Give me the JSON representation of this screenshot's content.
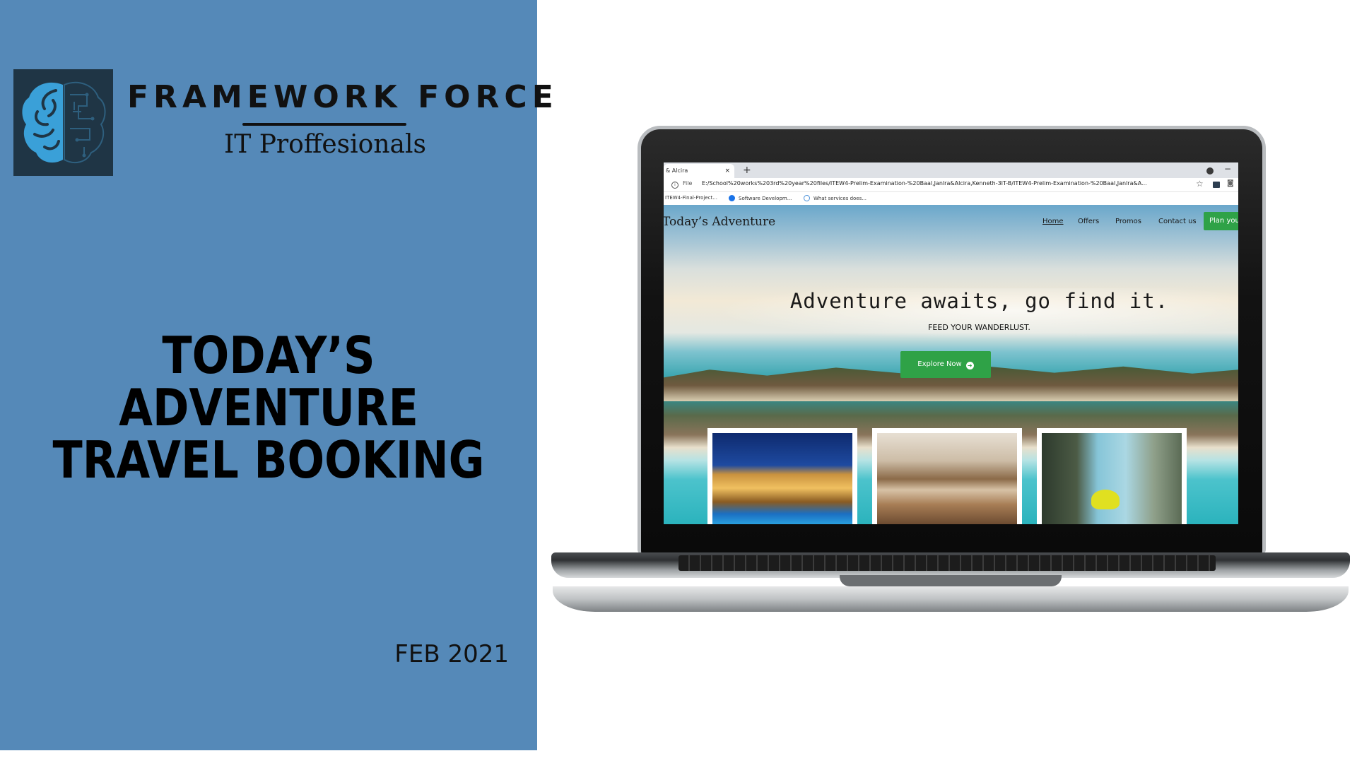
{
  "brand": {
    "name": "FRAMEWORK FORCE",
    "subtitle": "IT Proffesionals",
    "logo_icon": "brain-circuit-icon"
  },
  "headline": {
    "line1": "TODAY’S ADVENTURE",
    "line2": "TRAVEL BOOKING"
  },
  "date": "FEB 2021",
  "browser": {
    "tab_title": "& Alcira",
    "tab_close": "×",
    "new_tab": "+",
    "minimize": "−",
    "file_label": "File",
    "url": "E:/School%20works%203rd%20year%20files/ITEW4-Prelim-Examination-%20Baal,Janlra&Alcira,Kenneth-3IT-B/ITEW4-Prelim-Examination-%20Baal,Janlra&A...",
    "bookmarks": [
      "ITEW4-Final-Project...",
      "Software Developm...",
      "What services does..."
    ]
  },
  "site": {
    "logo": "Today’s Adventure",
    "nav": {
      "home": "Home",
      "offers": "Offers",
      "promos": "Promos",
      "contact": "Contact us",
      "plan": "Plan you"
    },
    "hero_title": "Adventure awaits, go find it.",
    "hero_subtitle": "FEED YOUR WANDERLUST.",
    "explore_button": "Explore Now",
    "colors": {
      "accent_green": "#2fa247",
      "panel_blue": "#5589b8"
    }
  }
}
